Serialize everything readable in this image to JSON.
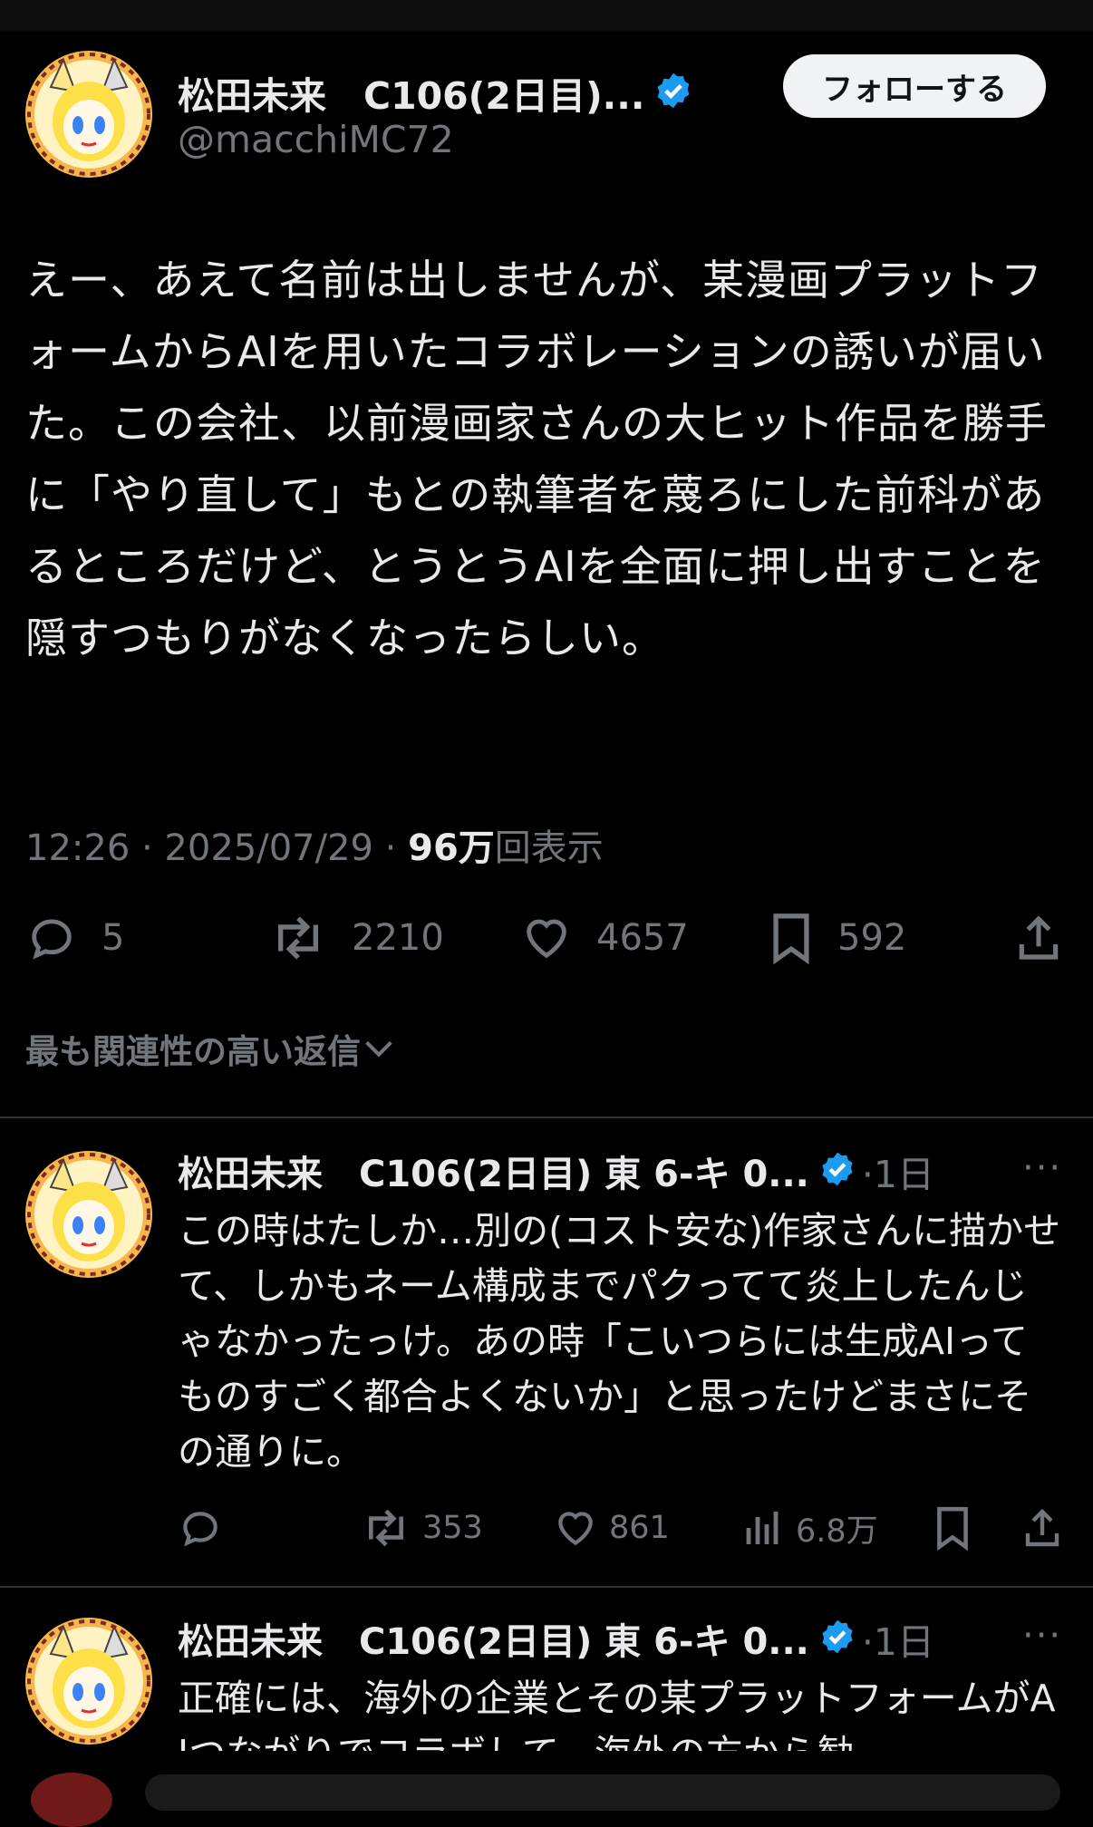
{
  "post": {
    "author_name": "松田未来　C106(2日目)...",
    "handle": "@macchiMC72",
    "follow_label": "フォローする",
    "body": "えー、あえて名前は出しませんが、某漫画プラットフォームからAIを用いたコラボレーションの誘いが届いた。この会社、以前漫画家さんの大ヒット作品を勝手に「やり直して」もとの執筆者を蔑ろにした前科があるところだけど、とうとうAIを全面に押し出すことを隠すつもりがなくなったらしい。",
    "time": "12:26 · 2025/07/29 · ",
    "views_count": "96万",
    "views_label": "回表示",
    "replies": "5",
    "reposts": "2210",
    "likes": "4657",
    "bookmarks": "592"
  },
  "related_label": "最も関連性の高い返信",
  "replies": [
    {
      "author_name": "松田未来　C106(2日目) 東 6-キ 0...",
      "time": "·1日",
      "more": "···",
      "body": "この時はたしか…別の(コスト安な)作家さんに描かせて、しかもネーム構成までパクってて炎上したんじゃなかったっけ。あの時「こいつらには生成AIってものすごく都合よくないか」と思ったけどまさにその通りに。",
      "reposts": "353",
      "likes": "861",
      "views": "6.8万"
    },
    {
      "author_name": "松田未来　C106(2日目) 東 6-キ 0...",
      "time": "·1日",
      "more": "···",
      "body": "正確には、海外の企業とその某プラットフォームがAIつながりでコラボして、海外の方から勧"
    }
  ],
  "colors": {
    "background": "#000000",
    "text": "#e7e9ea",
    "muted": "#71767b",
    "verified": "#1d9bf0",
    "follow_bg": "#eff3f4"
  }
}
